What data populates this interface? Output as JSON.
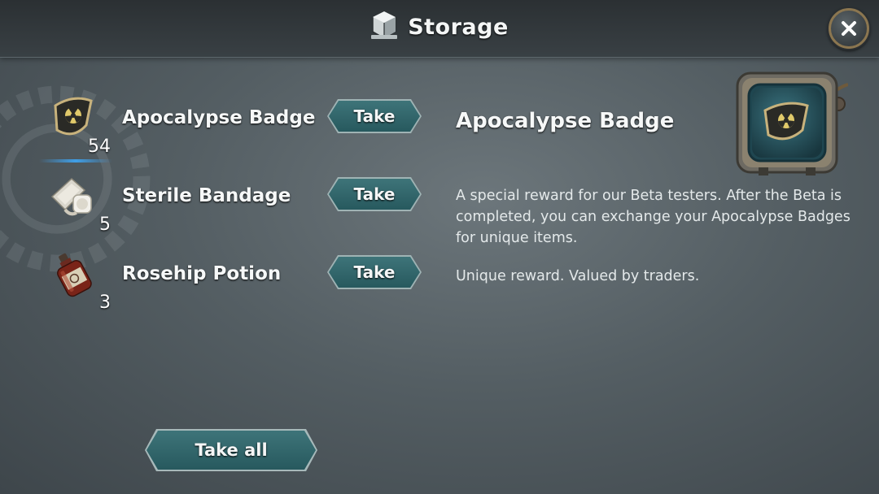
{
  "header": {
    "title": "Storage",
    "icon": "storage-box-icon",
    "close_icon": "close-icon"
  },
  "items": [
    {
      "name": "Apocalypse Badge",
      "count": "54",
      "icon": "apocalypse-badge-icon",
      "take_label": "Take",
      "selected": true
    },
    {
      "name": "Sterile Bandage",
      "count": "5",
      "icon": "sterile-bandage-icon",
      "take_label": "Take",
      "selected": false
    },
    {
      "name": "Rosehip Potion",
      "count": "3",
      "icon": "rosehip-potion-icon",
      "take_label": "Take",
      "selected": false
    }
  ],
  "take_all_label": "Take all",
  "detail": {
    "title": "Apocalypse Badge",
    "description": "A special reward for our Beta testers. After the Beta is completed, you can exchange your Apocalypse Badges for unique items.",
    "note": "Unique reward. Valued by traders.",
    "preview_icon": "apocalypse-badge-icon"
  },
  "colors": {
    "button": "#2f6468",
    "selection_glow": "#3f9fe8",
    "frame": "#8b7650"
  }
}
